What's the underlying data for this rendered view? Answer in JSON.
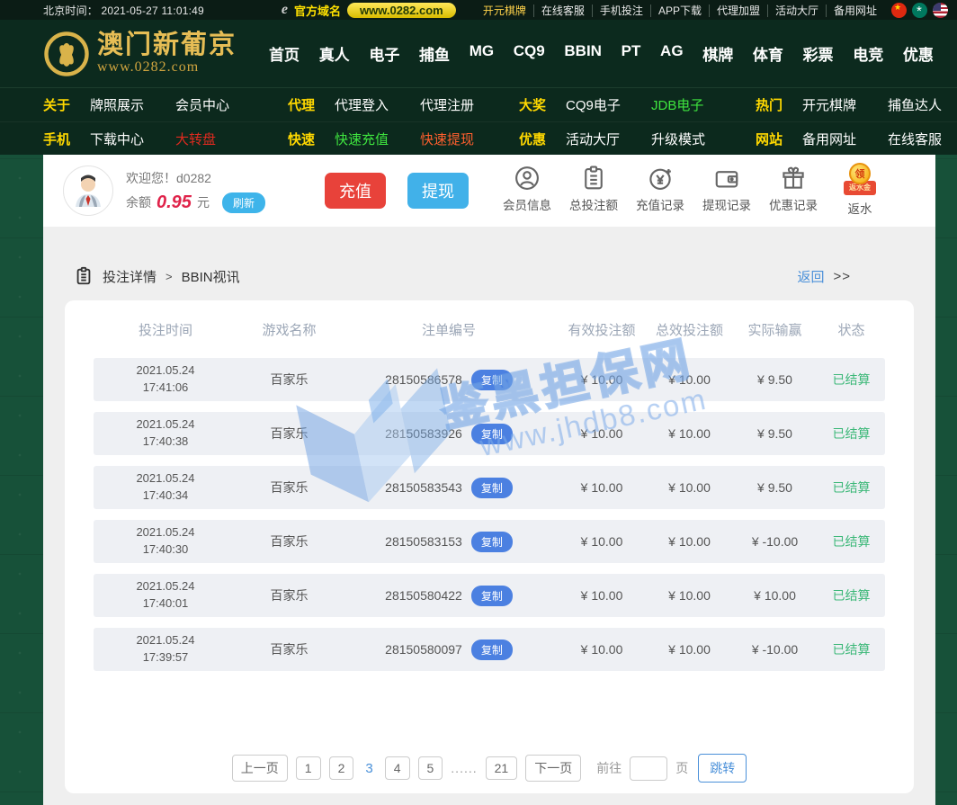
{
  "topbar": {
    "time": "北京时间： 2021-05-27 11:01:49",
    "domain_label": "官方域名",
    "domain_pill": "www.0282.com",
    "links": [
      {
        "label": "开元棋牌",
        "cls": "yellow"
      },
      {
        "label": "在线客服"
      },
      {
        "label": "手机投注"
      },
      {
        "label": "APP下载"
      },
      {
        "label": "代理加盟"
      },
      {
        "label": "活动大厅"
      },
      {
        "label": "备用网址"
      }
    ]
  },
  "logo": {
    "title": "澳门新葡京",
    "subtitle": "www.0282.com"
  },
  "mainnav": {
    "items": [
      "首页",
      "真人",
      "电子",
      "捕鱼",
      "MG",
      "CQ9",
      "BBIN",
      "PT",
      "AG",
      "棋牌",
      "体育",
      "彩票",
      "电竞",
      "优惠"
    ]
  },
  "subnav": {
    "row1": [
      {
        "tag": "关于",
        "l1": "牌照展示",
        "l2": "会员中心"
      },
      {
        "tag": "代理",
        "l1": "代理登入",
        "l2": "代理注册"
      },
      {
        "tag": "大奖",
        "l1": "CQ9电子",
        "l2": "JDB电子",
        "cls2": "green"
      },
      {
        "tag": "热门",
        "l1": "开元棋牌",
        "l2": "捕鱼达人"
      }
    ],
    "row2": [
      {
        "tag": "手机",
        "l1": "下载中心",
        "l2": "大转盘",
        "cls2": "red"
      },
      {
        "tag": "快速",
        "l1": "快速充值",
        "l2": "快速提现",
        "cls1": "green",
        "cls2": "orange"
      },
      {
        "tag": "优惠",
        "l1": "活动大厅",
        "l2": "升级模式"
      },
      {
        "tag": "网站",
        "l1": "备用网址",
        "l2": "在线客服"
      }
    ]
  },
  "userbar": {
    "welcome": "欢迎您！d0282",
    "balance_label": "余额",
    "balance_value": "0.95",
    "balance_unit": "元",
    "refresh_label": "刷新",
    "deposit_label": "充值",
    "withdraw_label": "提现",
    "rebate_coin": "领",
    "rebate_box": "返水金",
    "quick_icons": [
      {
        "label": "会员信息"
      },
      {
        "label": "总投注额"
      },
      {
        "label": "充值记录"
      },
      {
        "label": "提现记录"
      },
      {
        "label": "优惠记录"
      },
      {
        "label": "返水"
      }
    ]
  },
  "breadcrumb": {
    "section": "投注详情",
    "separator": ">",
    "current": "BBIN视讯",
    "back_label": "返回",
    "back_arrows": ">>"
  },
  "watermark": {
    "title": "鉴黑担保网",
    "url": "www.jhdb8.com"
  },
  "table": {
    "headers": [
      "投注时间",
      "游戏名称",
      "注单编号",
      "有效投注额",
      "总效投注额",
      "实际输赢",
      "状态"
    ],
    "copy_label": "复制",
    "rows": [
      {
        "date": "2021.05.24",
        "time": "17:41:06",
        "game": "百家乐",
        "order": "28150586578",
        "valid": "¥ 10.00",
        "total": "¥ 10.00",
        "winloss": "¥ 9.50",
        "status": "已结算"
      },
      {
        "date": "2021.05.24",
        "time": "17:40:38",
        "game": "百家乐",
        "order": "28150583926",
        "valid": "¥ 10.00",
        "total": "¥ 10.00",
        "winloss": "¥ 9.50",
        "status": "已结算"
      },
      {
        "date": "2021.05.24",
        "time": "17:40:34",
        "game": "百家乐",
        "order": "28150583543",
        "valid": "¥ 10.00",
        "total": "¥ 10.00",
        "winloss": "¥ 9.50",
        "status": "已结算"
      },
      {
        "date": "2021.05.24",
        "time": "17:40:30",
        "game": "百家乐",
        "order": "28150583153",
        "valid": "¥ 10.00",
        "total": "¥ 10.00",
        "winloss": "¥ -10.00",
        "status": "已结算"
      },
      {
        "date": "2021.05.24",
        "time": "17:40:01",
        "game": "百家乐",
        "order": "28150580422",
        "valid": "¥ 10.00",
        "total": "¥ 10.00",
        "winloss": "¥ 10.00",
        "status": "已结算"
      },
      {
        "date": "2021.05.24",
        "time": "17:39:57",
        "game": "百家乐",
        "order": "28150580097",
        "valid": "¥ 10.00",
        "total": "¥ 10.00",
        "winloss": "¥ -10.00",
        "status": "已结算"
      }
    ]
  },
  "pagination": {
    "items": [
      {
        "label": "上一页",
        "cls": "boxed"
      },
      {
        "label": "1",
        "cls": "boxed"
      },
      {
        "label": "2",
        "cls": "boxed"
      },
      {
        "label": "3",
        "cls": "current"
      },
      {
        "label": "4",
        "cls": "boxed"
      },
      {
        "label": "5",
        "cls": "boxed"
      },
      {
        "label": "......",
        "cls": "dots"
      },
      {
        "label": "21",
        "cls": "boxed"
      },
      {
        "label": "下一页",
        "cls": "boxed"
      }
    ],
    "goto_label": "前往",
    "page_unit": "页",
    "jump_label": "跳转"
  },
  "colors": {
    "page_green": "#175139",
    "nav_dark": "#0c2a1e",
    "accent_yellow": "#ffd800",
    "gold": "#e6bd55",
    "deposit_red": "#e8423a",
    "withdraw_blue": "#41b1e9",
    "copy_blue": "#4b80e1",
    "status_green": "#3cb878",
    "balance_red": "#e0234a",
    "link_blue": "#4a90d9"
  }
}
